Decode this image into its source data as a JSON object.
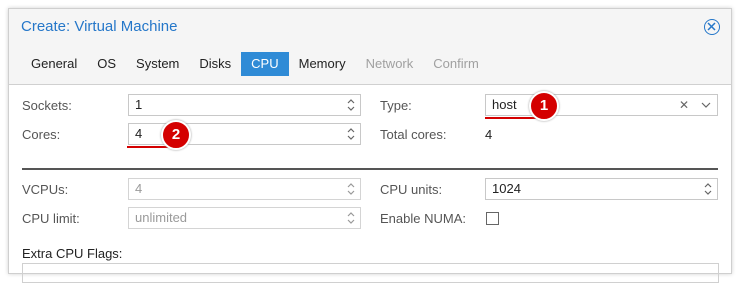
{
  "dialog": {
    "title": "Create: Virtual Machine"
  },
  "tabs": [
    {
      "label": "General",
      "state": "normal"
    },
    {
      "label": "OS",
      "state": "normal"
    },
    {
      "label": "System",
      "state": "normal"
    },
    {
      "label": "Disks",
      "state": "normal"
    },
    {
      "label": "CPU",
      "state": "active"
    },
    {
      "label": "Memory",
      "state": "normal"
    },
    {
      "label": "Network",
      "state": "disabled"
    },
    {
      "label": "Confirm",
      "state": "disabled"
    }
  ],
  "cpu": {
    "sockets_label": "Sockets:",
    "sockets_value": "1",
    "cores_label": "Cores:",
    "cores_value": "4",
    "type_label": "Type:",
    "type_value": "host",
    "total_cores_label": "Total cores:",
    "total_cores_value": "4",
    "vcpus_label": "VCPUs:",
    "vcpus_value": "4",
    "cpu_limit_label": "CPU limit:",
    "cpu_limit_value": "unlimited",
    "cpu_units_label": "CPU units:",
    "cpu_units_value": "1024",
    "enable_numa_label": "Enable NUMA:",
    "enable_numa_checked": false,
    "extra_flags_label": "Extra CPU Flags:"
  },
  "annotations": [
    {
      "number": "1"
    },
    {
      "number": "2"
    }
  ],
  "colors": {
    "accent": "#2f8bd6",
    "title": "#2577c9",
    "annotation": "#d40000"
  }
}
